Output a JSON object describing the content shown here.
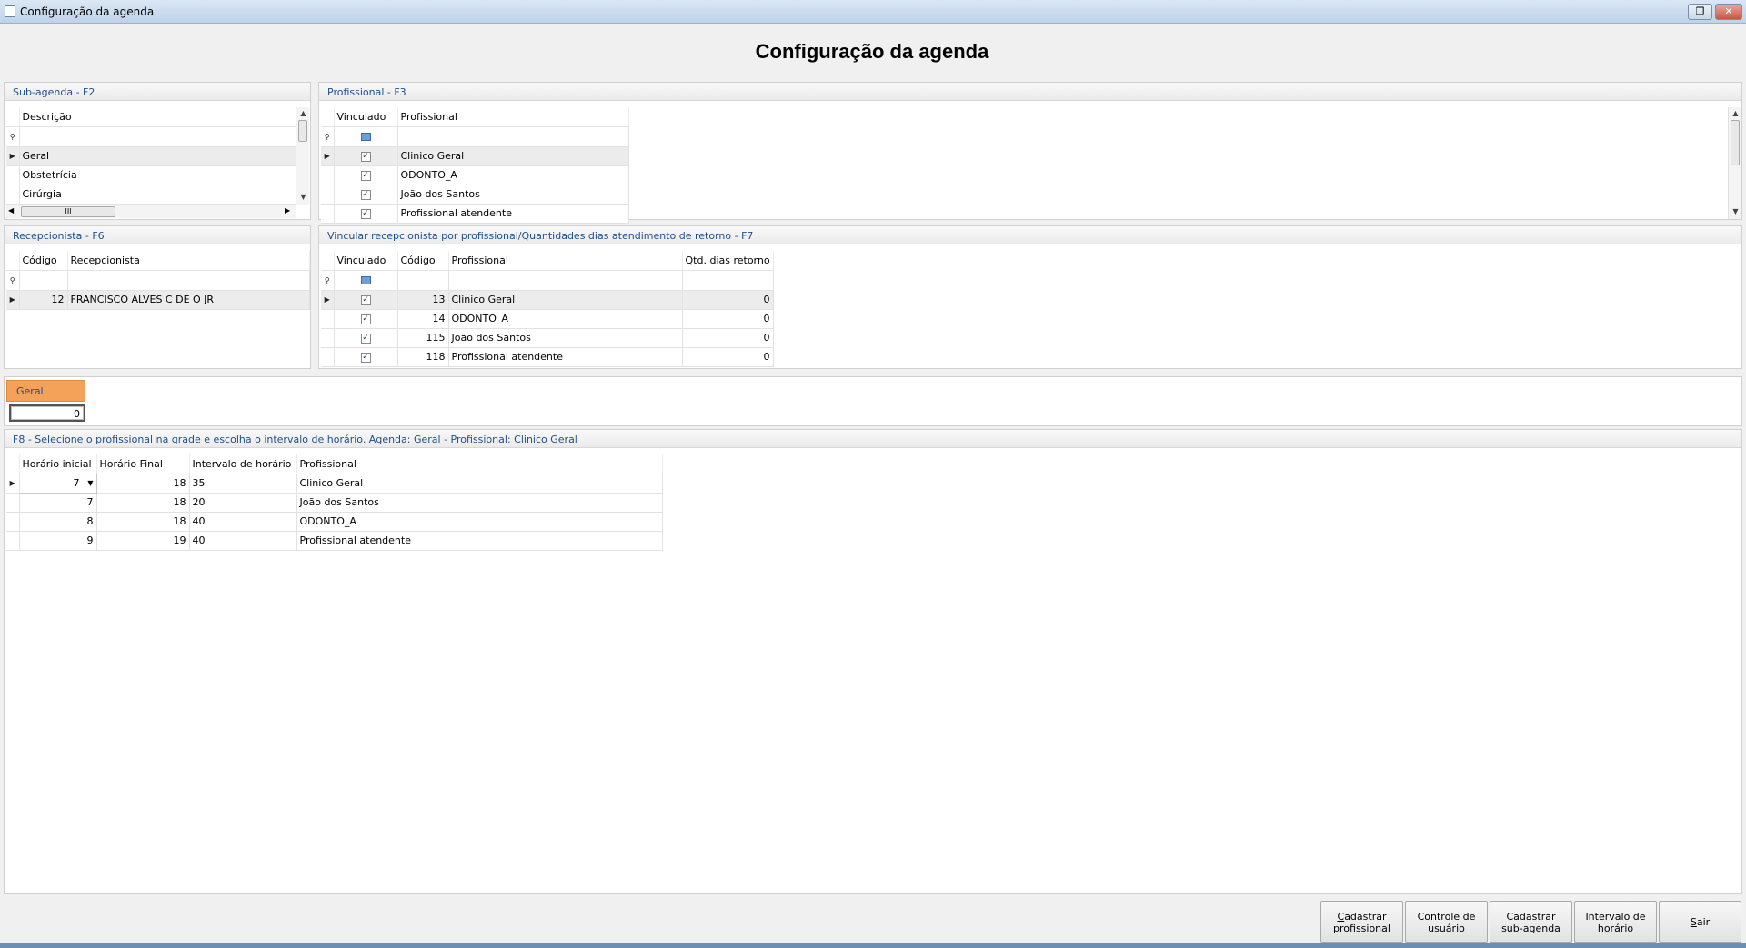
{
  "window": {
    "title": "Configuração da agenda"
  },
  "heading": "Configuração da agenda",
  "subagenda": {
    "title": "Sub-agenda - F2",
    "columns": [
      "Descrição"
    ],
    "rows": [
      "Geral",
      "Obstetrícia",
      "Cirúrgia"
    ],
    "hscroll_thumb": "III"
  },
  "profissional": {
    "title": "Profissional - F3",
    "columns": [
      "Vinculado",
      "Profissional"
    ],
    "rows": [
      {
        "vinculado": "✓",
        "nome": "Clinico Geral"
      },
      {
        "vinculado": "✓",
        "nome": "ODONTO_A"
      },
      {
        "vinculado": "✓",
        "nome": "João dos Santos"
      },
      {
        "vinculado": "✓",
        "nome": "Profissional atendente"
      }
    ]
  },
  "recepcionista": {
    "title": "Recepcionista - F6",
    "columns": [
      "Código",
      "Recepcionista"
    ],
    "rows": [
      {
        "codigo": "12",
        "nome": "FRANCISCO ALVES C DE O JR"
      }
    ]
  },
  "vincular": {
    "title": "Vincular recepcionista por profissional/Quantidades dias atendimento de retorno - F7",
    "columns": [
      "Vinculado",
      "Código",
      "Profissional",
      "Qtd. dias retorno"
    ],
    "rows": [
      {
        "vinculado": "✓",
        "codigo": "13",
        "nome": "Clinico Geral",
        "qtd": "0"
      },
      {
        "vinculado": "✓",
        "codigo": "14",
        "nome": "ODONTO_A",
        "qtd": "0"
      },
      {
        "vinculado": "✓",
        "codigo": "115",
        "nome": "João dos Santos",
        "qtd": "0"
      },
      {
        "vinculado": "✓",
        "codigo": "118",
        "nome": "Profissional atendente",
        "qtd": "0"
      }
    ]
  },
  "tab": {
    "label": "Geral",
    "value": "0"
  },
  "horarios": {
    "title": "F8 - Selecione o profissional na grade e escolha o intervalo de horário. Agenda: Geral - Profissional: Clinico Geral",
    "columns": [
      "Horário inicial",
      "Horário Final",
      "Intervalo de horário",
      "Profissional"
    ],
    "rows": [
      {
        "inicial": "7",
        "final": "18",
        "intervalo": "35",
        "profissional": "Clinico Geral"
      },
      {
        "inicial": "7",
        "final": "18",
        "intervalo": "20",
        "profissional": "João dos Santos"
      },
      {
        "inicial": "8",
        "final": "18",
        "intervalo": "40",
        "profissional": "ODONTO_A"
      },
      {
        "inicial": "9",
        "final": "19",
        "intervalo": "40",
        "profissional": "Profissional atendente"
      }
    ]
  },
  "buttons": {
    "cadastrar_profissional": {
      "u": "C",
      "rest": "adastrar\nprofissional"
    },
    "controle_usuario": {
      "u": "",
      "rest": "Controle de\nusuário"
    },
    "cadastrar_subagenda": {
      "u": "",
      "rest": "Cadastrar\nsub-agenda"
    },
    "intervalo_horario": {
      "u": "",
      "rest": "Intervalo de\nhorário"
    },
    "sair": {
      "u": "S",
      "rest": "air"
    }
  },
  "icons": {
    "filter": "filter-icon",
    "row_indicator": "row-pointer-icon",
    "dropdown": "chevron-down-icon"
  }
}
